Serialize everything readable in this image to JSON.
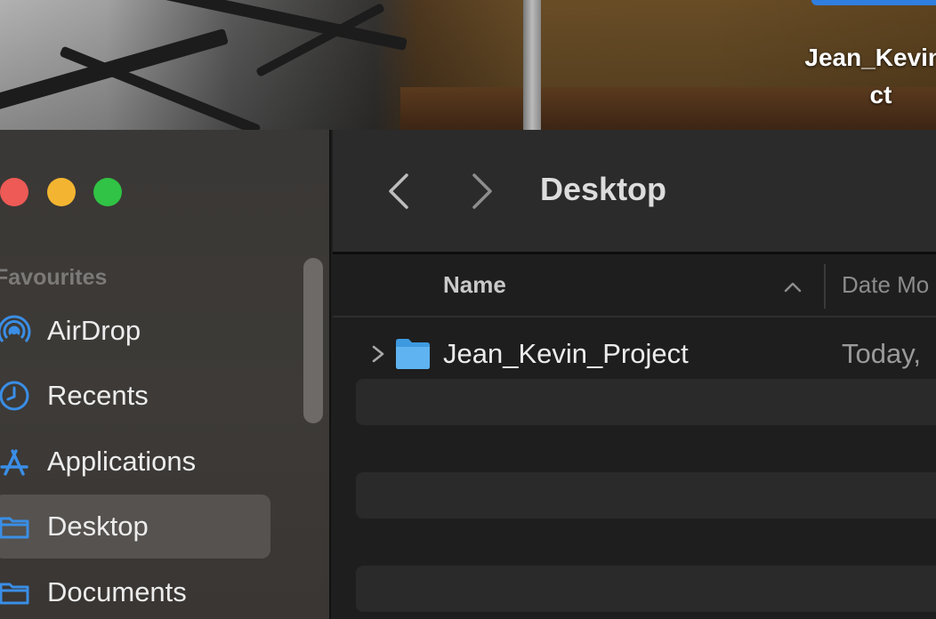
{
  "desktop": {
    "selected_item_label_line1": "Jean_Kevin_",
    "selected_item_label_line2": "ct"
  },
  "window": {
    "toolbar": {
      "title": "Desktop",
      "back_icon": "chevron-left-icon",
      "forward_icon": "chevron-right-icon"
    },
    "sidebar": {
      "heading": "Favourites",
      "items": [
        {
          "label": "AirDrop",
          "icon": "airdrop-icon",
          "active": false
        },
        {
          "label": "Recents",
          "icon": "clock-icon",
          "active": false
        },
        {
          "label": "Applications",
          "icon": "applications-icon",
          "active": false
        },
        {
          "label": "Desktop",
          "icon": "folder-icon",
          "active": true
        },
        {
          "label": "Documents",
          "icon": "folder-icon",
          "active": false
        }
      ]
    },
    "columns": {
      "name": "Name",
      "date": "Date Mo"
    },
    "files": [
      {
        "name": "Jean_Kevin_Project",
        "date": "Today,",
        "type": "folder"
      }
    ]
  },
  "colors": {
    "accent": "#3a8ee6",
    "close": "#ee5a55",
    "minimize": "#f3b531",
    "maximize": "#30c345",
    "folder": "#5fb3f0"
  }
}
